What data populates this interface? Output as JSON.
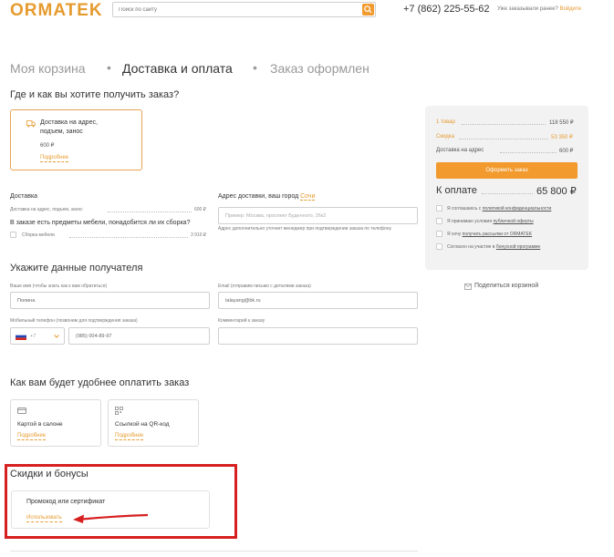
{
  "header": {
    "logo": "ORMATEK",
    "search_placeholder": "Поиск по сайту",
    "phone": "+7 (862) 225-55-62",
    "login_question": "Уже заказывали ранее?",
    "login_link": "Войдите"
  },
  "steps": [
    "Моя корзина",
    "Доставка и оплата",
    "Заказ оформлен"
  ],
  "delivery": {
    "heading": "Где и как вы хотите получить заказ?",
    "option_title_1": "Доставка на адрес,",
    "option_title_2": "подъем, занос",
    "option_price": "600 ₽",
    "option_link": "Подробнее",
    "section_label": "Доставка",
    "line_label": "Доставка на адрес, подъем, занос",
    "line_price": "600 ₽",
    "assembly_question": "В заказе есть предметы мебели, понадобится ли их сборка?",
    "assembly_label": "Сборка мебели",
    "assembly_price": "3 910 ₽",
    "address_label": "Адрес доставки, ваш город",
    "city": "Сочи",
    "address_placeholder": "Пример: Москва, проспект Буденного, 26к2",
    "address_hint": "Адрес дополнительно уточнит менеджер при подтверждении заказа по телефону"
  },
  "recipient": {
    "heading": "Укажите данные получателя",
    "name_label": "Ваше имя (чтобы знать как к вам обратиться)",
    "name_value": "Полина",
    "email_label": "Email (отправим письмо с деталями заказа)",
    "email_value": "talayang@bk.ru",
    "phone_label": "Мобильный телефон (позвоним для подтверждения заказа)",
    "phone_code": "+7",
    "phone_value": "(985) 004-89-97",
    "comment_label": "Комментарий к заказу"
  },
  "payment": {
    "heading": "Как вам будет удобнее оплатить заказ",
    "opt1": "Картой в салоне",
    "opt2": "Ссылкой на QR-код",
    "link": "Подробнее"
  },
  "discounts": {
    "heading": "Скидки и бонусы",
    "promo_title": "Промокод или сертификат",
    "promo_link": "Использовать"
  },
  "summary": {
    "items_label": "1 товар",
    "items_value": "118 550 ₽",
    "discount_label": "Скидка",
    "discount_value": "53 350 ₽",
    "delivery_label": "Доставка на адрес",
    "delivery_value": "600 ₽",
    "order_button": "Оформить заказ",
    "pay_label": "К оплате",
    "pay_value": "65 800 ₽",
    "agree1_text": "Я соглашаюсь с",
    "agree1_link": "политикой конфиденциальности",
    "agree2_text": "Я принимаю условия",
    "agree2_link": "публичной оферты",
    "agree3_text": "Я хочу",
    "agree3_link": "получать рассылки от ORMATEK",
    "agree4_text": "Согласен на участие в",
    "agree4_link": "бонусной программе",
    "share": "Поделиться корзиной"
  },
  "colors": {
    "accent": "#f29a2e",
    "highlight": "#d61f1f"
  }
}
